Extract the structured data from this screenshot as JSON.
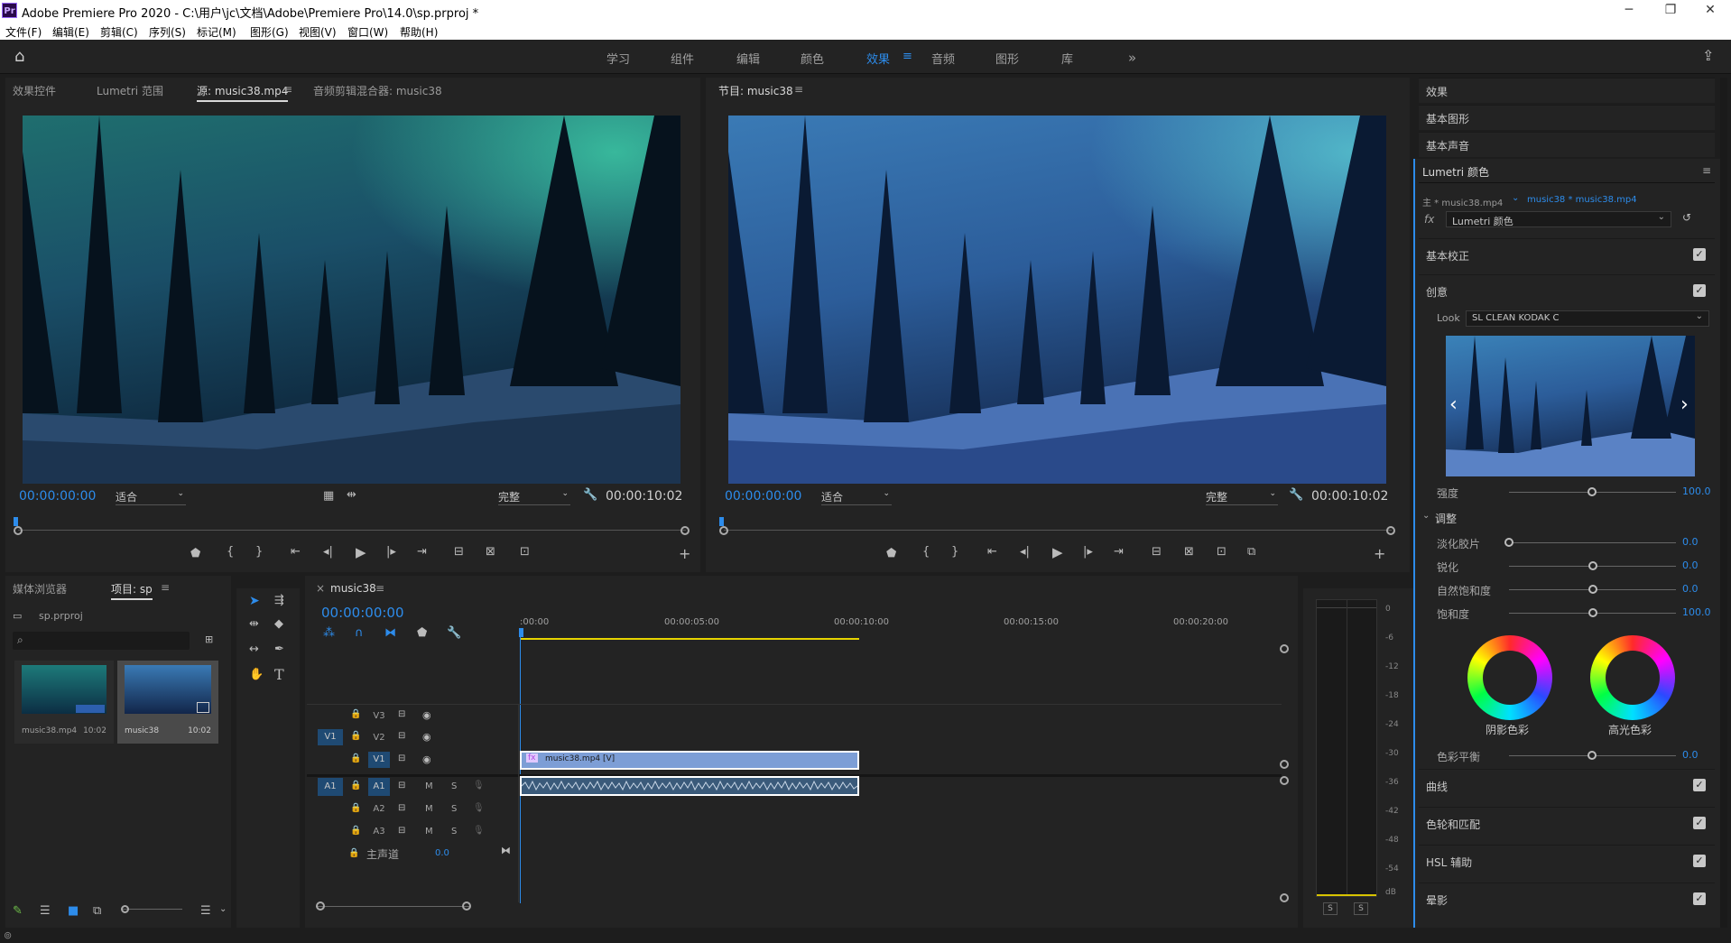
{
  "window": {
    "title": "Adobe Premiere Pro 2020 - C:\\用户\\jc\\文档\\Adobe\\Premiere Pro\\14.0\\sp.prproj *",
    "app_badge": "Pr"
  },
  "menu": [
    "文件(F)",
    "编辑(E)",
    "剪辑(C)",
    "序列(S)",
    "标记(M)",
    "图形(G)",
    "视图(V)",
    "窗口(W)",
    "帮助(H)"
  ],
  "workspaces": [
    "学习",
    "组件",
    "编辑",
    "颜色",
    "效果",
    "音频",
    "图形",
    "库"
  ],
  "active_workspace": "效果",
  "source_panel": {
    "tabs": [
      "效果控件",
      "Lumetri 范围",
      "源: music38.mp4",
      "音频剪辑混合器: music38"
    ],
    "active_tab": "源: music38.mp4",
    "timecode_in": "00:00:00:00",
    "fit": "适合",
    "quality": "完整",
    "timecode_out": "00:00:10:02"
  },
  "program_panel": {
    "title": "节目: music38",
    "timecode_in": "00:00:00:00",
    "fit": "适合",
    "quality": "完整",
    "timecode_out": "00:00:10:02"
  },
  "project_panel": {
    "tabs": [
      "媒体浏览器",
      "项目: sp"
    ],
    "active_tab": "项目: sp",
    "file": "sp.prproj",
    "items": [
      {
        "name": "music38.mp4",
        "duration": "10:02"
      },
      {
        "name": "music38",
        "duration": "10:02"
      }
    ]
  },
  "timeline": {
    "sequence": "music38",
    "timecode": "00:00:00:00",
    "ruler": [
      ":00:00",
      "00:00:05:00",
      "00:00:10:00",
      "00:00:15:00",
      "00:00:20:00"
    ],
    "video_tracks": [
      "V3",
      "V2",
      "V1"
    ],
    "audio_tracks": [
      "A1",
      "A2",
      "A3"
    ],
    "source_v": "V1",
    "source_a": "A1",
    "master_label": "主声道",
    "master_value": "0.0",
    "video_clip": "music38.mp4 [V]",
    "mute": "M",
    "solo": "S"
  },
  "audio_meter": {
    "scale": [
      "0",
      "-6",
      "-12",
      "-18",
      "-24",
      "-30",
      "-36",
      "-42",
      "-48",
      "-54",
      "dB"
    ],
    "solo": [
      "S",
      "S"
    ]
  },
  "right_panel": {
    "stacked": [
      "效果",
      "基本图形",
      "基本声音"
    ],
    "lumetri_title": "Lumetri 颜色",
    "master_clip": "主 * music38.mp4",
    "seq_clip": "music38 * music38.mp4",
    "fx_label": "fx",
    "effect": "Lumetri 颜色",
    "basic": "基本校正",
    "creative": "创意",
    "look_label": "Look",
    "look_value": "SL CLEAN KODAK C",
    "intensity_label": "强度",
    "intensity_value": "100.0",
    "adjust_label": "调整",
    "sliders": [
      {
        "label": "淡化胶片",
        "value": "0.0",
        "level": 0
      },
      {
        "label": "锐化",
        "value": "0.0",
        "level": 0.5
      },
      {
        "label": "自然饱和度",
        "value": "0.0",
        "level": 0.5
      },
      {
        "label": "饱和度",
        "value": "100.0",
        "level": 0.5
      }
    ],
    "wheel_shadow": "阴影色彩",
    "wheel_highlight": "高光色彩",
    "balance_label": "色彩平衡",
    "balance_value": "0.0",
    "sections": [
      "曲线",
      "色轮和匹配",
      "HSL 辅助",
      "晕影"
    ]
  },
  "colors": {
    "accent": "#2d8ceb",
    "panel": "#232323",
    "bg": "#1d1d1d",
    "clip_video": "#7d9ed6",
    "clip_audio": "#3a5a7a",
    "playhead": "#2d8ceb"
  }
}
